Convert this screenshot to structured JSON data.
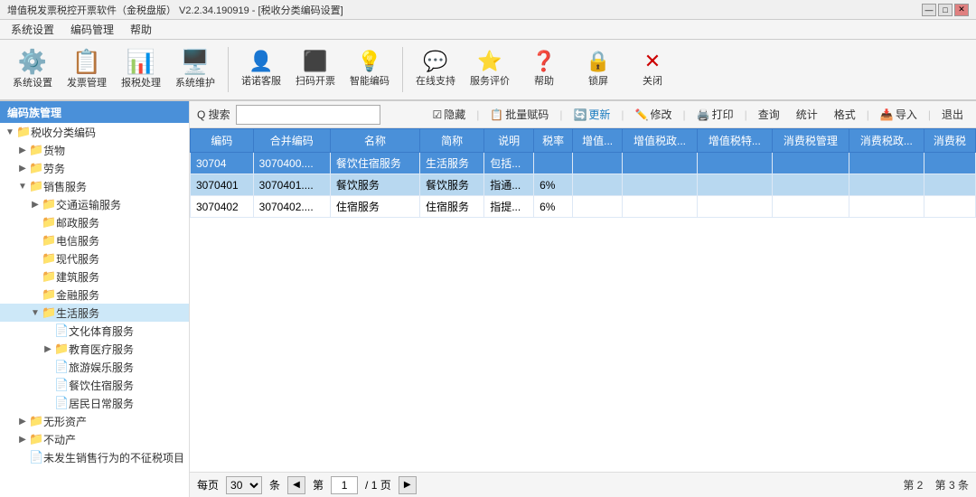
{
  "titleBar": {
    "title": "增值税发票税控开票软件（金税盘版） V2.2.34.190919 - [税收分类编码设置]",
    "buttons": [
      "—",
      "□",
      "✕"
    ]
  },
  "menuBar": {
    "items": [
      "系统设置",
      "编码管理",
      "帮助"
    ]
  },
  "toolbar": {
    "buttons": [
      {
        "id": "system-settings",
        "icon": "⚙",
        "label": "系统设置",
        "active": false
      },
      {
        "id": "invoice-mgmt",
        "icon": "📄",
        "label": "发票管理",
        "active": false
      },
      {
        "id": "tax-processing",
        "icon": "📊",
        "label": "报税处理",
        "active": false
      },
      {
        "id": "system-maint",
        "icon": "🖥",
        "label": "系统维护",
        "active": false
      },
      {
        "id": "nuonuo-service",
        "icon": "👤",
        "label": "诺诺客服",
        "active": false
      },
      {
        "id": "scan-invoice",
        "icon": "⬛",
        "label": "扫码开票",
        "active": false
      },
      {
        "id": "smart-code",
        "icon": "💡",
        "label": "智能编码",
        "active": false
      },
      {
        "id": "online-support",
        "icon": "❓",
        "label": "在线支持",
        "active": false
      },
      {
        "id": "service-eval",
        "icon": "⭐",
        "label": "服务评价",
        "active": false
      },
      {
        "id": "help",
        "icon": "❓",
        "label": "帮助",
        "active": false
      },
      {
        "id": "lock-screen",
        "icon": "🔒",
        "label": "锁屏",
        "active": false
      },
      {
        "id": "close",
        "icon": "✕",
        "label": "关闭",
        "active": false
      }
    ]
  },
  "sidebar": {
    "header": "编码族管理",
    "tree": [
      {
        "id": "root",
        "indent": "indent-1",
        "expand": "▼",
        "icon": "📁",
        "label": "税收分类编码",
        "level": 1
      },
      {
        "id": "goods",
        "indent": "indent-2",
        "expand": "▶",
        "icon": "📁",
        "label": "货物",
        "level": 2
      },
      {
        "id": "labor",
        "indent": "indent-2",
        "expand": "▶",
        "icon": "📁",
        "label": "劳务",
        "level": 2
      },
      {
        "id": "sales-service",
        "indent": "indent-2",
        "expand": "▼",
        "icon": "📁",
        "label": "销售服务",
        "level": 2
      },
      {
        "id": "transport",
        "indent": "indent-3",
        "expand": "▶",
        "icon": "📁",
        "label": "交通运输服务",
        "level": 3
      },
      {
        "id": "postal",
        "indent": "indent-3",
        "expand": " ",
        "icon": "📁",
        "label": "邮政服务",
        "level": 3
      },
      {
        "id": "telecom",
        "indent": "indent-3",
        "expand": " ",
        "icon": "📁",
        "label": "电信服务",
        "level": 3
      },
      {
        "id": "modern",
        "indent": "indent-3",
        "expand": " ",
        "icon": "📁",
        "label": "现代服务",
        "level": 3
      },
      {
        "id": "construction",
        "indent": "indent-3",
        "expand": " ",
        "icon": "📁",
        "label": "建筑服务",
        "level": 3
      },
      {
        "id": "finance",
        "indent": "indent-3",
        "expand": " ",
        "icon": "📁",
        "label": "金融服务",
        "level": 3
      },
      {
        "id": "life",
        "indent": "indent-3",
        "expand": "▼",
        "icon": "📁",
        "label": "生活服务",
        "level": 3,
        "selected": true
      },
      {
        "id": "culture-sports",
        "indent": "indent-4",
        "expand": " ",
        "icon": "📄",
        "label": "文化体育服务",
        "level": 4
      },
      {
        "id": "edu-medical",
        "indent": "indent-4",
        "expand": "▶",
        "icon": "📁",
        "label": "教育医疗服务",
        "level": 4
      },
      {
        "id": "travel-entertain",
        "indent": "indent-4",
        "expand": " ",
        "icon": "📄",
        "label": "旅游娱乐服务",
        "level": 4
      },
      {
        "id": "catering-hotel",
        "indent": "indent-4",
        "expand": " ",
        "icon": "📄",
        "label": "餐饮住宿服务",
        "level": 4
      },
      {
        "id": "resident-daily",
        "indent": "indent-4",
        "expand": " ",
        "icon": "📄",
        "label": "居民日常服务",
        "level": 4
      },
      {
        "id": "intangible",
        "indent": "indent-2",
        "expand": "▶",
        "icon": "📁",
        "label": "无形资产",
        "level": 2
      },
      {
        "id": "real-estate",
        "indent": "indent-2",
        "expand": "▶",
        "icon": "📁",
        "label": "不动产",
        "level": 2
      },
      {
        "id": "non-tax",
        "indent": "indent-2",
        "expand": " ",
        "icon": "📄",
        "label": "未发生销售行为的不征税项目",
        "level": 2
      }
    ]
  },
  "actionBar": {
    "searchLabel": "Q 搜索",
    "searchPlaceholder": "",
    "hidden": "隐藏",
    "batchCode": "批量赋码",
    "update": "更新",
    "modify": "修改",
    "print": "打印",
    "query": "查询",
    "stat": "统计",
    "format": "格式",
    "import": "导入",
    "exit": "退出"
  },
  "table": {
    "columns": [
      "编码",
      "合并编码",
      "名称",
      "简称",
      "说明",
      "税率",
      "增值...",
      "增值税政...",
      "增值税特...",
      "消费税管理",
      "消费税政...",
      "消费税"
    ],
    "rows": [
      {
        "id": "row1",
        "code": "30704",
        "mergeCode": "3070400....",
        "name": "餐饮住宿服务",
        "shortName": "生活服务",
        "desc": "包括...",
        "rate": "",
        "v1": "",
        "v2": "",
        "v3": "",
        "v4": "",
        "v5": "",
        "v6": "",
        "selected": true
      },
      {
        "id": "row2",
        "code": "3070401",
        "mergeCode": "3070401....",
        "name": "餐饮服务",
        "shortName": "餐饮服务",
        "desc": "指通...",
        "rate": "6%",
        "v1": "",
        "v2": "",
        "v3": "",
        "v4": "",
        "v5": "",
        "v6": "",
        "selected": false,
        "highlighted": true
      },
      {
        "id": "row3",
        "code": "3070402",
        "mergeCode": "3070402....",
        "name": "住宿服务",
        "shortName": "住宿服务",
        "desc": "指提...",
        "rate": "6%",
        "v1": "",
        "v2": "",
        "v3": "",
        "v4": "",
        "v5": "",
        "v6": "",
        "selected": false
      }
    ]
  },
  "footer": {
    "perPageLabel": "每页",
    "perPageValue": "30",
    "recordLabel": "条",
    "prevBtn": "◀",
    "nextBtn": "▶",
    "firstPageLabel": "第",
    "pageValue": "1",
    "totalPageLabel": "/ 1 页",
    "rightText1": "第 2",
    "rightText2": "第 3 条"
  }
}
